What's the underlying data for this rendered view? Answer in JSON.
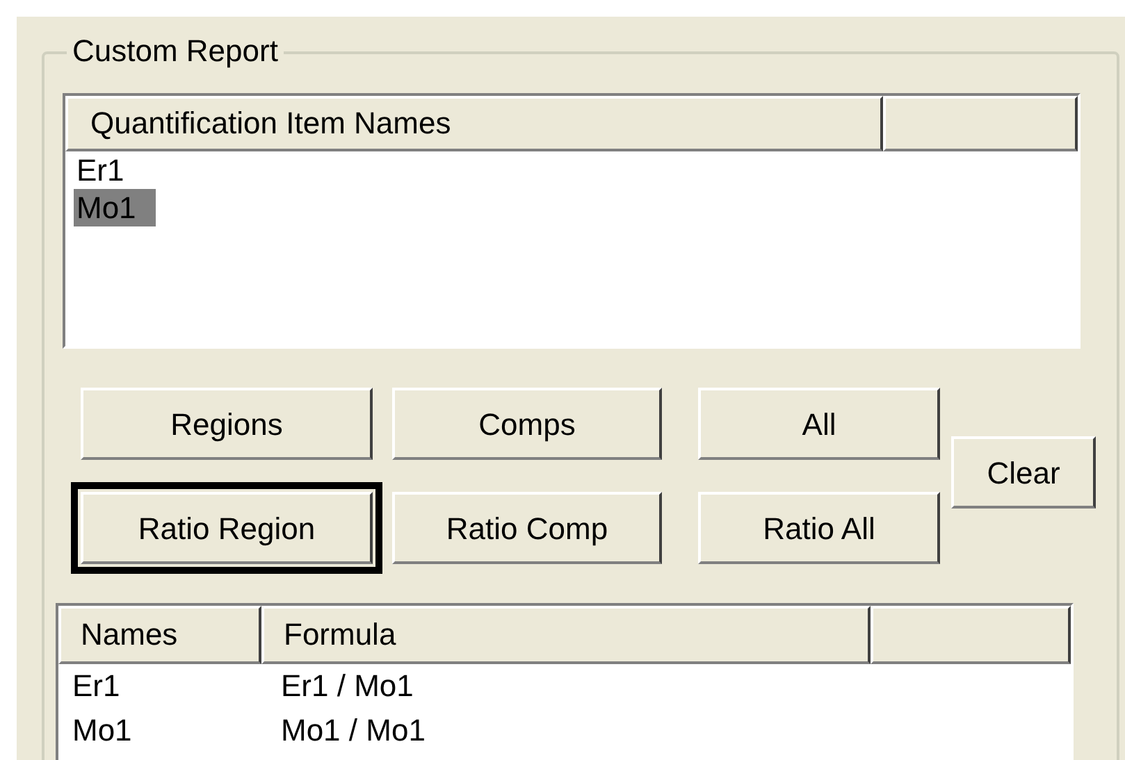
{
  "group": {
    "title": "Custom Report"
  },
  "items_list": {
    "columns": [
      "Quantification Item Names"
    ],
    "rows": [
      {
        "name": "Er1",
        "selected": false
      },
      {
        "name": "Mo1",
        "selected": true
      }
    ]
  },
  "button_columns": [
    [
      {
        "label": "Regions",
        "focused": false
      },
      {
        "label": "Ratio Region",
        "focused": true
      }
    ],
    [
      {
        "label": "Comps",
        "focused": false
      },
      {
        "label": "Ratio Comp",
        "focused": false
      }
    ],
    [
      {
        "label": "All",
        "focused": false
      },
      {
        "label": "Ratio All",
        "focused": false
      }
    ]
  ],
  "side_button": {
    "label": "Clear",
    "focused": false
  },
  "formula_list": {
    "columns": [
      "Names",
      "Formula"
    ],
    "rows": [
      {
        "cells": [
          "Er1",
          "Er1 / Mo1"
        ]
      },
      {
        "cells": [
          "Mo1",
          "Mo1 / Mo1"
        ]
      }
    ]
  }
}
